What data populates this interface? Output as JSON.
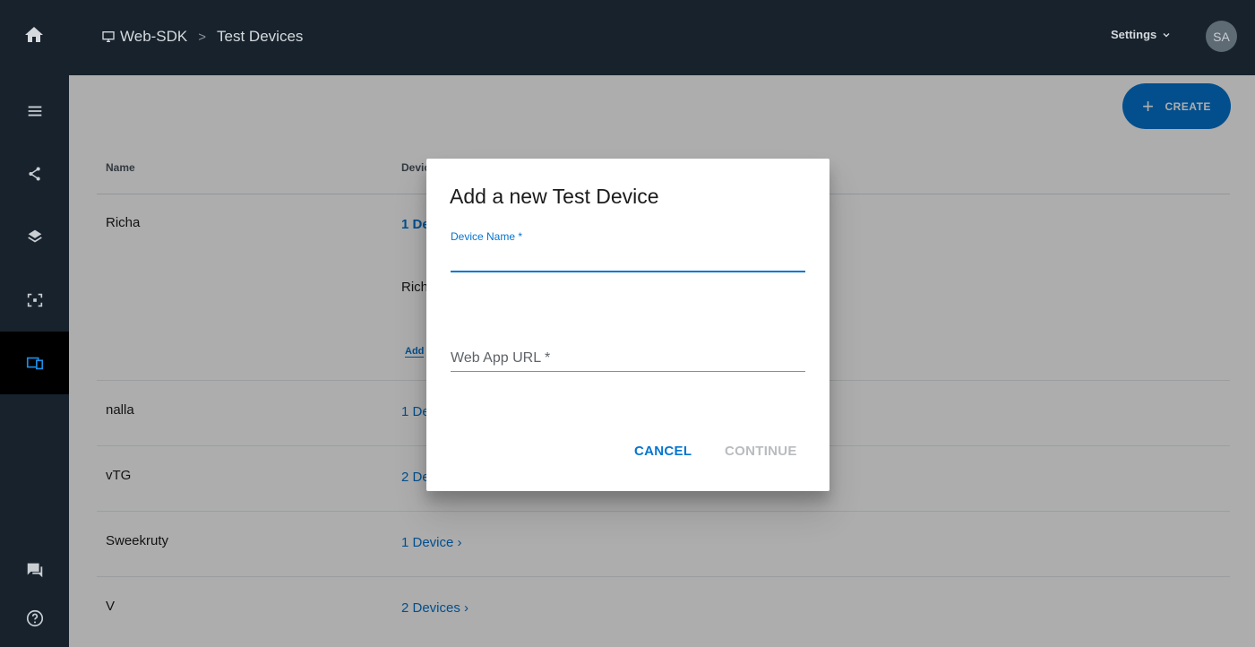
{
  "topbar": {
    "breadcrumb": {
      "project": "Web-SDK",
      "separator": ">",
      "current": "Test Devices"
    },
    "settings_label": "Settings",
    "avatar_initials": "SA"
  },
  "sidebar": {
    "items": [
      {
        "icon": "menu-icon"
      },
      {
        "icon": "share-nodes-icon"
      },
      {
        "icon": "layers-icon"
      },
      {
        "icon": "scan-frame-icon"
      },
      {
        "icon": "devices-icon",
        "active": true
      },
      {
        "icon": "chat-icon"
      },
      {
        "icon": "help-icon"
      }
    ]
  },
  "main": {
    "create_label": "CREATE",
    "table": {
      "headers": {
        "name": "Name",
        "devices": "Devic"
      },
      "rows": [
        {
          "name": "Richa",
          "devices": "1 De",
          "sub_name": "Rich",
          "add_link": "Add"
        },
        {
          "name": "nalla",
          "devices": "1 Devic"
        },
        {
          "name": "vTG",
          "devices": "2 De"
        },
        {
          "name": "Sweekruty",
          "devices": "1 Device"
        },
        {
          "name": "V",
          "devices": "2 Devices"
        }
      ]
    }
  },
  "dialog": {
    "title": "Add a new Test Device",
    "device_name_label": "Device Name *",
    "device_name_value": "",
    "web_app_url_placeholder": "Web App URL *",
    "web_app_url_value": "",
    "cancel_label": "CANCEL",
    "continue_label": "CONTINUE"
  },
  "colors": {
    "nav_bg": "#17222c",
    "accent": "#0575d0",
    "disabled": "#b9bcbf"
  }
}
